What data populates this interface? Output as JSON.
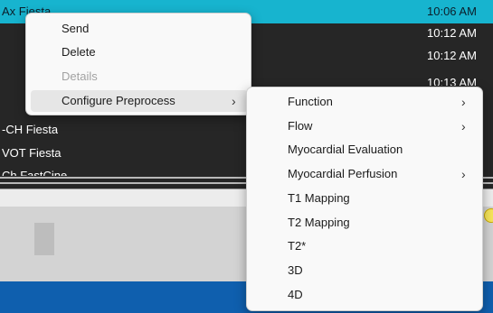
{
  "series_list": {
    "rows": [
      {
        "name": "Ax Fiesta",
        "time": "10:06 AM",
        "selected": true
      },
      {
        "name": "",
        "time": "10:12 AM",
        "selected": false
      },
      {
        "name": "",
        "time": "10:12 AM",
        "selected": false
      },
      {
        "name": "",
        "time": "10:13 AM",
        "selected": false
      },
      {
        "name": "-CH Fiesta",
        "time": "",
        "selected": false
      },
      {
        "name": "VOT Fiesta",
        "time": "",
        "selected": false
      }
    ],
    "partial_row": "Ch FastCine"
  },
  "context_menu": {
    "send": "Send",
    "delete": "Delete",
    "details": "Details",
    "configure_preprocess": "Configure Preprocess"
  },
  "preprocess_submenu": {
    "function": "Function",
    "flow": "Flow",
    "myocardial_evaluation": "Myocardial Evaluation",
    "myocardial_perfusion": "Myocardial Perfusion",
    "t1_mapping": "T1 Mapping",
    "t2_mapping": "T2 Mapping",
    "t2_star": "T2*",
    "three_d": "3D",
    "four_d": "4D"
  },
  "icons": {
    "submenu_chevron": "chevron-right-icon"
  },
  "colors": {
    "selected_row": "#17b4cf",
    "list_background": "#262626",
    "menu_background": "#f9f9f9",
    "bottom_bar": "#0f5fae"
  }
}
